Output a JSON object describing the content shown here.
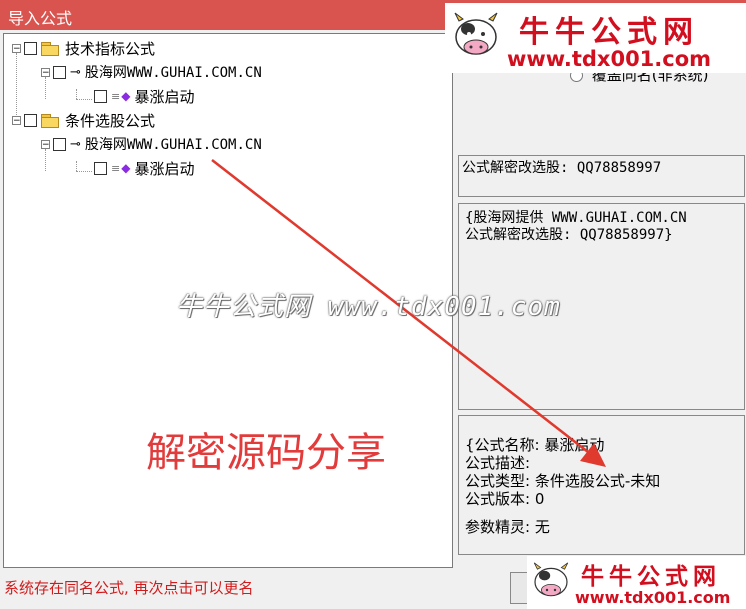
{
  "window": {
    "title": "导入公式"
  },
  "tree": {
    "groups": [
      {
        "label": "技术指标公式",
        "author": "股海网WWW.GUHAI.COM.CN",
        "formula": "暴涨启动"
      },
      {
        "label": "条件选股公式",
        "author": "股海网WWW.GUHAI.COM.CN",
        "formula": "暴涨启动"
      }
    ],
    "expander_symbol": "−"
  },
  "right": {
    "overwrite_option": "覆盖同名(非系统)",
    "qq_line": "公式解密改选股: QQ78858997",
    "desc_line1": "{股海网提供 WWW.GUHAI.COM.CN",
    "desc_line2": "公式解密改选股: QQ78858997}",
    "info": {
      "name_label": "{公式名称:",
      "name_value": "暴涨启动",
      "desc_label": "公式描述:",
      "type_label": "公式类型:",
      "type_value": "条件选股公式-未知",
      "version_label": "公式版本:",
      "version_value": "0",
      "param_label": "参数精灵:",
      "param_value": "无"
    }
  },
  "status": {
    "message": "系统存在同名公式, 再次点击可以更名"
  },
  "overlay": {
    "watermark_text": "牛牛公式网 www.tdx001.com",
    "caption": "解密源码分享",
    "logo_cn": "牛牛公式网",
    "logo_url": "www.tdx001.com"
  },
  "colors": {
    "titlebar": "#d9534f",
    "accent_red": "#d10f1f",
    "status_red": "#d01c1c"
  }
}
